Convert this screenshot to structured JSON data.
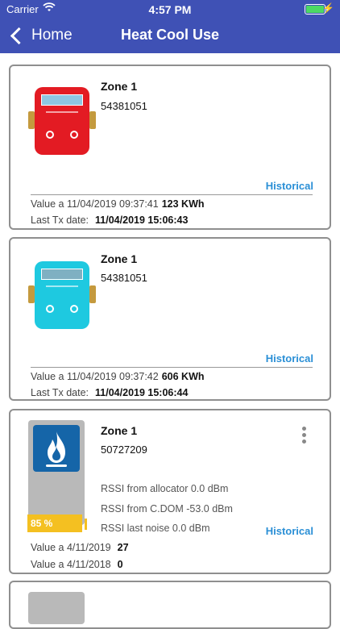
{
  "status_bar": {
    "carrier": "Carrier",
    "time": "4:57 PM",
    "battery_level": 1.0
  },
  "nav": {
    "back_label": "Home",
    "title": "Heat Cool Use"
  },
  "cards": [
    {
      "zone": "Zone 1",
      "serial": "54381051",
      "historical": "Historical",
      "value_label": "Value a 11/04/2019 09:37:41",
      "value": "123 KWh",
      "last_tx_label": "Last Tx date:",
      "last_tx": "11/04/2019 15:06:43",
      "meter_color": "#e31b23"
    },
    {
      "zone": "Zone 1",
      "serial": "54381051",
      "historical": "Historical",
      "value_label": "Value a 11/04/2019 09:37:42",
      "value": "606 KWh",
      "last_tx_label": "Last Tx date:",
      "last_tx": "11/04/2019 15:06:44",
      "meter_color": "#1ec9e0"
    },
    {
      "zone": "Zone 1",
      "serial": "50727209",
      "historical": "Historical",
      "battery_percent": "85 %",
      "rssi_allocator": "RSSI from allocator 0.0 dBm",
      "rssi_cdom": "RSSI from C.DOM -53.0 dBm",
      "rssi_noise": "RSSI last noise 0.0 dBm",
      "value1_label": "Value a 4/11/2019",
      "value1": "27",
      "value2_label": "Value a 4/11/2018",
      "value2": "0"
    }
  ]
}
